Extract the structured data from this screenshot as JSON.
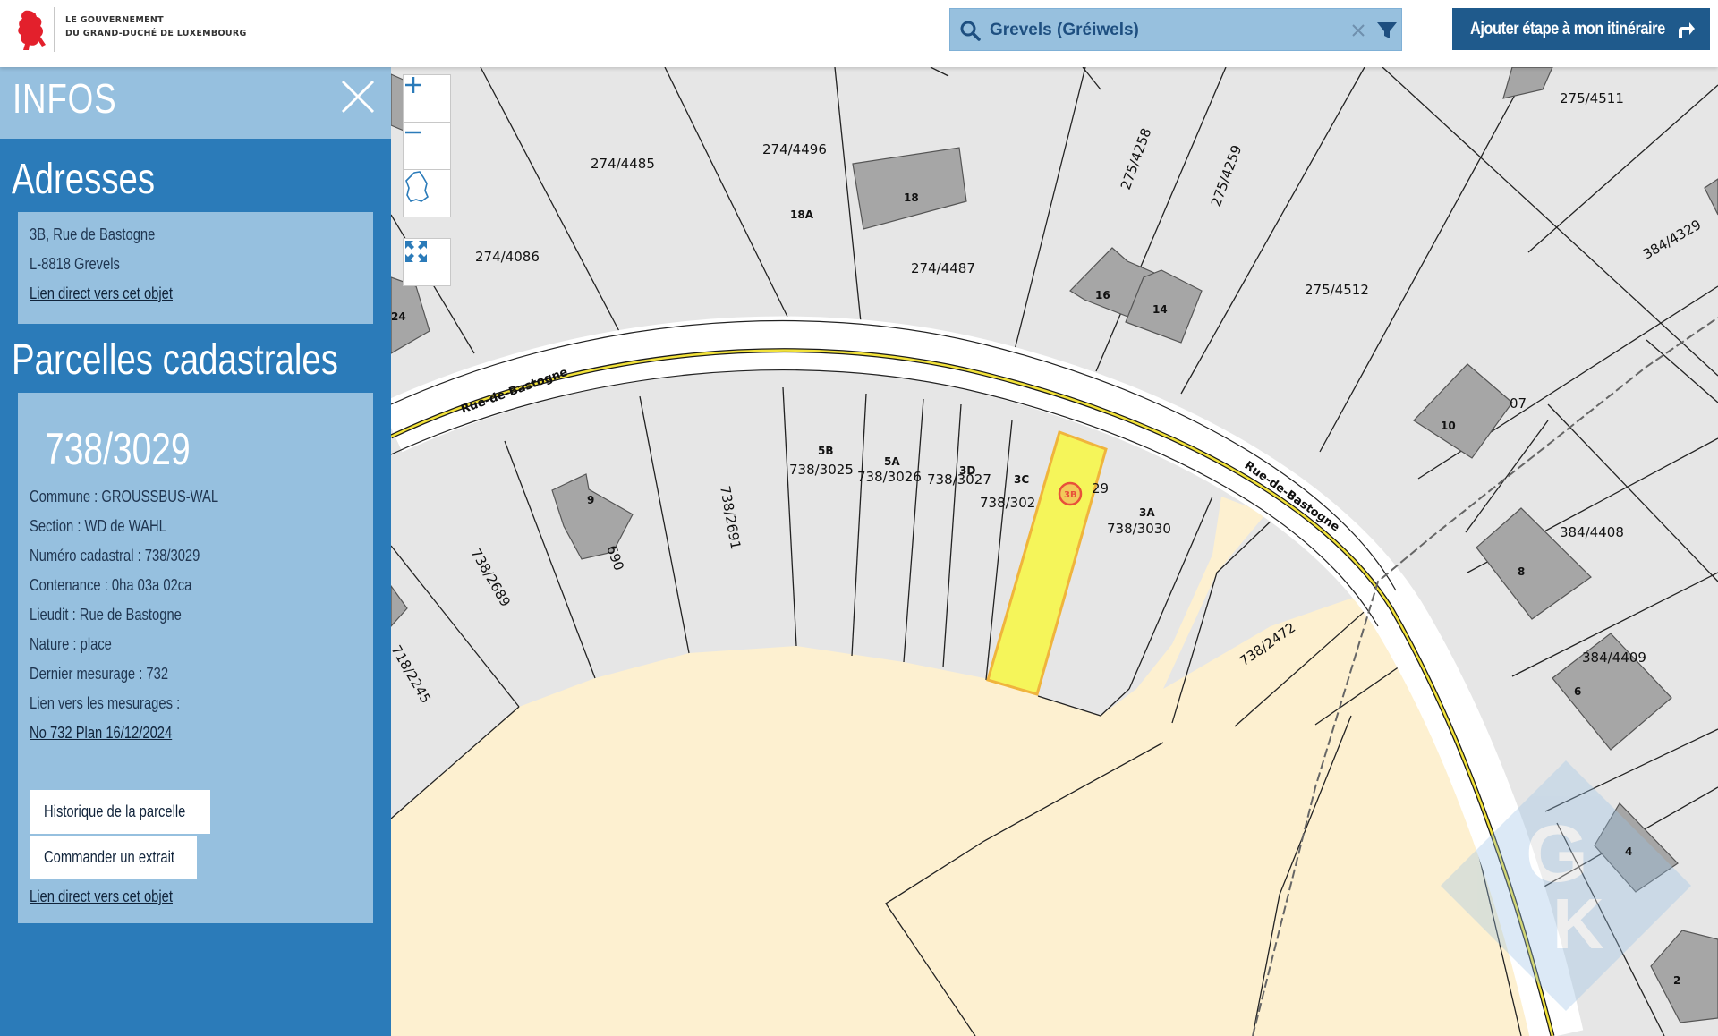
{
  "header": {
    "gov_line1": "Le Gouvernement",
    "gov_line2": "du Grand-Duché de Luxembourg",
    "search": {
      "value": "Grevels (Gréiwels)"
    },
    "route_button_label": "Ajouter étape à mon itinéraire"
  },
  "sidebar": {
    "title": "INFOS",
    "addresses": {
      "title": "Adresses",
      "street": "3B, Rue de Bastogne",
      "locality": "L-8818 Grevels",
      "link": "Lien direct vers cet objet"
    },
    "parcels": {
      "title": "Parcelles cadastrales",
      "number": "738/3029",
      "commune": "Commune : GROUSSBUS-WAL",
      "section": "Section : WD de WAHL",
      "numero": "Numéro cadastral : 738/3029",
      "contenance": "Contenance : 0ha 03a 02ca",
      "lieudit": "Lieudit : Rue de Bastogne",
      "nature": "Nature : place",
      "dernier_mesurage": "Dernier mesurage : 732",
      "mesurages_label": "Lien vers les mesurages :",
      "mesurage_link": "No 732 Plan 16/12/2024",
      "history_button": "Historique de la parcelle",
      "order_button": "Commander un extrait",
      "link": "Lien direct vers cet objet"
    }
  },
  "map": {
    "street_name": "Rue de Bastogne",
    "parcel_labels": [
      "274/4485",
      "274/4496",
      "274/4086",
      "274/4487",
      "275/4258",
      "275/4259",
      "275/4512",
      "275/4511",
      "384/4329",
      "384/4408",
      "384/4409",
      "738/3025",
      "738/3026",
      "738/3027",
      "738/302",
      "29",
      "738/3030",
      "738/2691",
      "738/2689",
      "690",
      "718/2245",
      "738/2472",
      "07",
      "2"
    ],
    "house_numbers": [
      "18",
      "18A",
      "16",
      "14",
      "10",
      "8",
      "6",
      "4",
      "2",
      "9",
      "24",
      "5B",
      "5A",
      "3D",
      "3C",
      "3B",
      "3A"
    ],
    "colors": {
      "sidebar": "#2b7bb9",
      "card": "#96c0df",
      "route_button": "#1f5a8c",
      "parcel_fill": "#e6e6e6",
      "open_land": "#fdf0d0",
      "building": "#a6a6a6",
      "highlight": "#f5f55a",
      "highlight_border": "#f0b43c"
    }
  }
}
